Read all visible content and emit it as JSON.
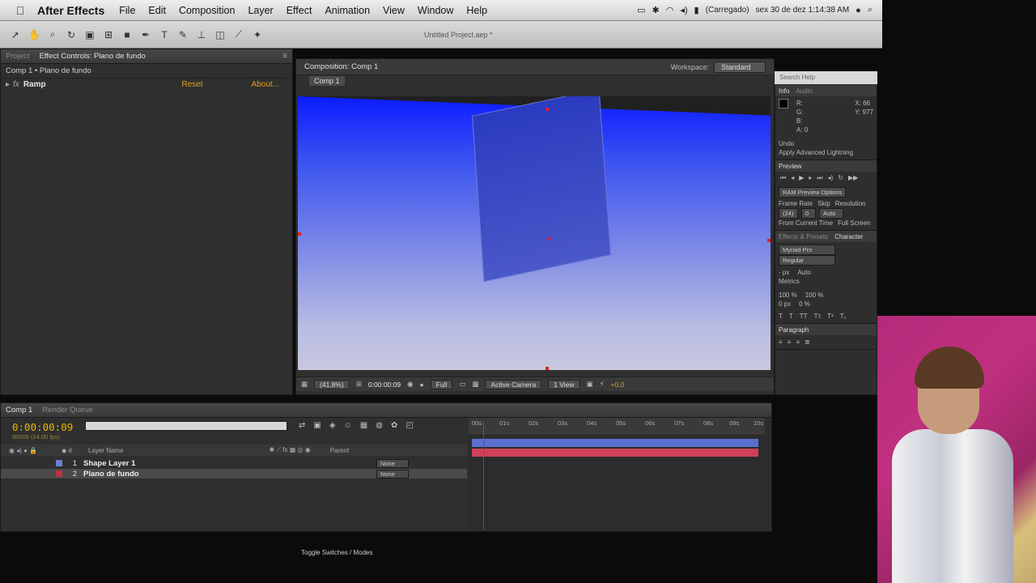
{
  "menubar": {
    "app_name": "After Effects",
    "items": [
      "File",
      "Edit",
      "Composition",
      "Layer",
      "Effect",
      "Animation",
      "View",
      "Window",
      "Help"
    ],
    "status": "(Carregado)",
    "datetime": "sex 30 de dez  1:14:38 AM"
  },
  "toolbar": {
    "document_title": "Untitled Project.aep *"
  },
  "effect_panel": {
    "tabs": [
      "Project",
      "Effect Controls: Plano de fundo"
    ],
    "subtitle": "Comp 1 • Plano de fundo",
    "effect_name": "Ramp",
    "reset_label": "Reset",
    "about_label": "About..."
  },
  "comp_panel": {
    "tab": "Composition: Comp 1",
    "comp_tab": "Comp 1",
    "workspace_label": "Workspace:",
    "workspace_value": "Standard",
    "zoom": "(41,8%)",
    "timecode": "0:00:00:09",
    "resolution": "Full",
    "camera": "Active Camera",
    "views": "1 View",
    "exposure": "+0,0"
  },
  "right_panel": {
    "search_placeholder": "Search Help",
    "info_tabs": [
      "Info",
      "Audio"
    ],
    "info_channels": "R:\nG:\nB:\nA: 0",
    "info_coords": "X: 66\nY: 977",
    "undo_label": "Undo",
    "undo_action": "Apply Advanced Lightning",
    "preview_tab": "Preview",
    "ram_preview": "RAM Preview Options",
    "frame_rate_label": "Frame Rate",
    "skip_label": "Skip",
    "resolution_label": "Resolution",
    "frame_rate_value": "(24)",
    "skip_value": "0",
    "resolution_value": "Auto",
    "from_current": "From Current Time",
    "full_screen": "Full Screen",
    "char_tabs": [
      "Effects & Presets",
      "Character"
    ],
    "font": "Myriad Pro",
    "style": "Regular",
    "size": "- px",
    "leading": "Auto",
    "tracking": "Metrics",
    "vscale": "100 %",
    "hscale": "100 %",
    "baseline": "0 px",
    "tsume": "0 %",
    "paragraph_tab": "Paragraph"
  },
  "timeline": {
    "tabs": [
      "Comp 1",
      "Render Queue"
    ],
    "time": "0:00:00:09",
    "fps": "00009 (24.00 fps)",
    "col_layer_name": "Layer Name",
    "col_parent": "Parent",
    "layers": [
      {
        "num": "1",
        "name": "Shape Layer 1",
        "parent": "None",
        "color": "#6a7fd8"
      },
      {
        "num": "2",
        "name": "Plano de fundo",
        "parent": "None",
        "color": "#c03040"
      }
    ],
    "ruler_ticks": [
      "00s",
      "01s",
      "02s",
      "03s",
      "04s",
      "05s",
      "06s",
      "07s",
      "08s",
      "09s",
      "10s"
    ],
    "footer": "Toggle Switches / Modes"
  }
}
